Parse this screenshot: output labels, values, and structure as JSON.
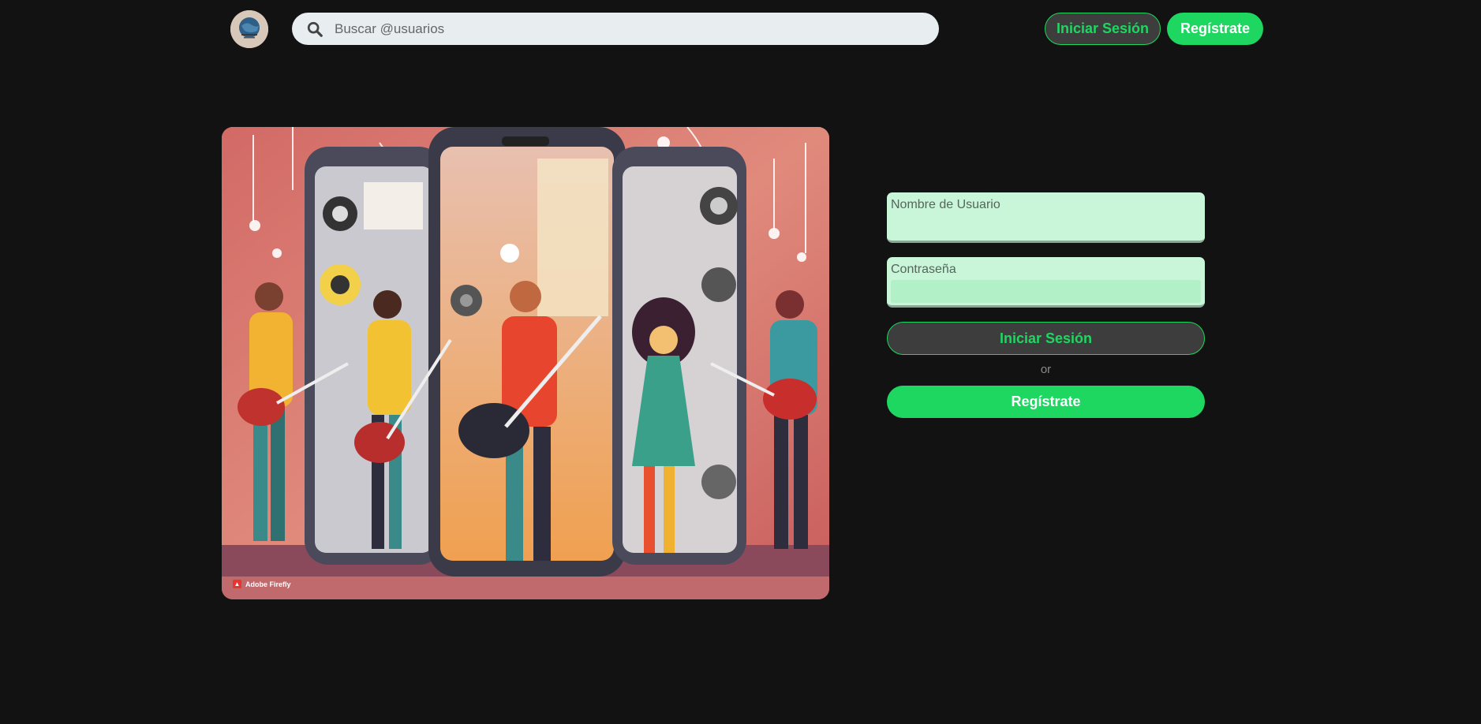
{
  "header": {
    "logo_icon": "logo-avatar",
    "search_icon": "search-icon",
    "search_placeholder": "Buscar @usuarios",
    "login_label": "Iniciar Sesión",
    "signup_label": "Regístrate"
  },
  "hero": {
    "image_subject": "musicians-with-guitars-and-phones",
    "watermark": "Adobe Firefly"
  },
  "form": {
    "username_label": "Nombre de Usuario",
    "password_label": "Contraseña",
    "login_label": "Iniciar Sesión",
    "or_text": "or",
    "signup_label": "Regístrate"
  },
  "colors": {
    "background": "#121212",
    "accent": "#1ed760",
    "input_bg": "#c9f5d9",
    "dark_button": "#3d3d3d"
  }
}
